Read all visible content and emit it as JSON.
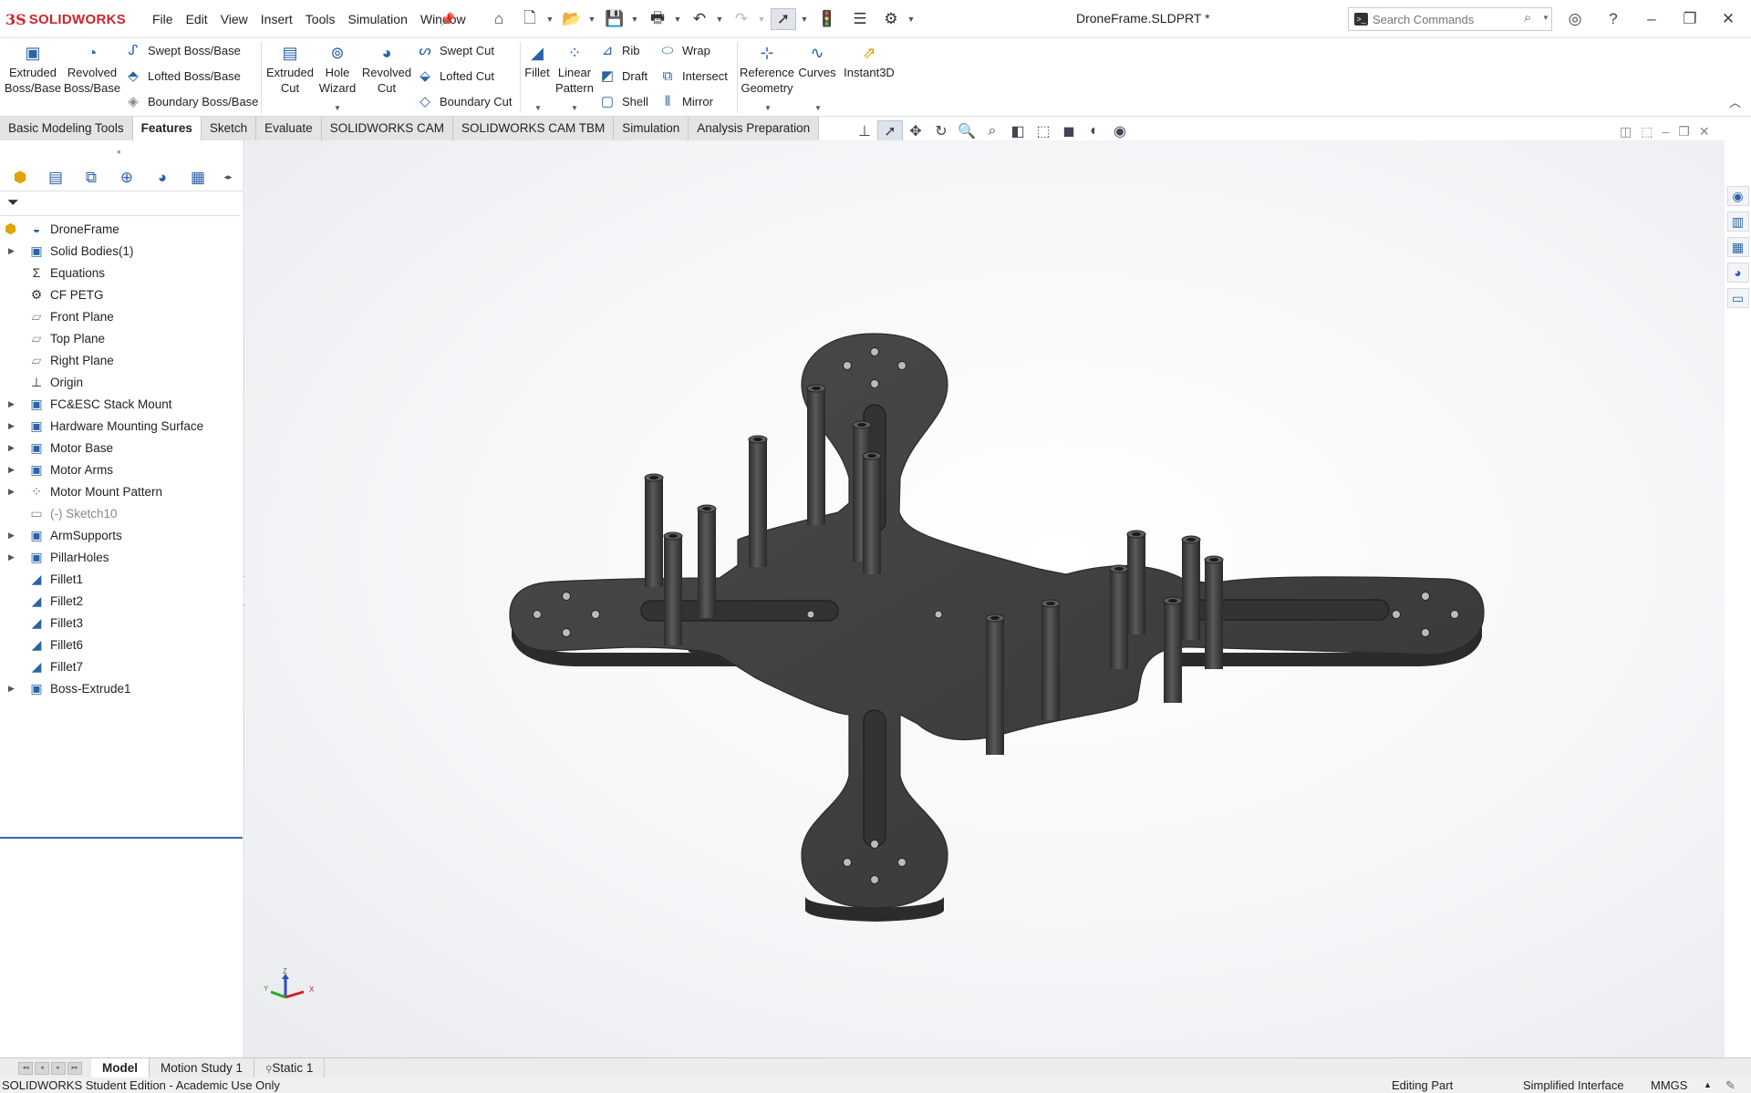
{
  "app": {
    "brand_mark": "3S",
    "brand_name": "SOLIDWORKS",
    "document_title": "DroneFrame.SLDPRT *"
  },
  "menu": [
    "File",
    "Edit",
    "View",
    "Insert",
    "Tools",
    "Simulation",
    "Window"
  ],
  "search": {
    "placeholder": "Search Commands"
  },
  "ribbon": {
    "extruded_boss": [
      "Extruded",
      "Boss/Base"
    ],
    "revolved_boss": [
      "Revolved",
      "Boss/Base"
    ],
    "swept_boss": "Swept Boss/Base",
    "lofted_boss": "Lofted Boss/Base",
    "boundary_boss": "Boundary Boss/Base",
    "extruded_cut": [
      "Extruded",
      "Cut"
    ],
    "hole_wizard": [
      "Hole",
      "Wizard"
    ],
    "revolved_cut": [
      "Revolved",
      "Cut"
    ],
    "swept_cut": "Swept Cut",
    "lofted_cut": "Lofted Cut",
    "boundary_cut": "Boundary Cut",
    "fillet": "Fillet",
    "linear_pattern": [
      "Linear",
      "Pattern"
    ],
    "rib": "Rib",
    "draft": "Draft",
    "shell": "Shell",
    "wrap": "Wrap",
    "intersect": "Intersect",
    "mirror": "Mirror",
    "reference_geometry": [
      "Reference",
      "Geometry"
    ],
    "curves": "Curves",
    "instant3d": "Instant3D"
  },
  "command_tabs": [
    "Basic Modeling Tools",
    "Features",
    "Sketch",
    "Evaluate",
    "SOLIDWORKS CAM",
    "SOLIDWORKS CAM TBM",
    "Simulation",
    "Analysis Preparation"
  ],
  "active_command_tab": "Features",
  "tree": {
    "root": "DroneFrame",
    "items": [
      {
        "label": "Solid Bodies(1)",
        "expandable": true,
        "icon": "folder-icon"
      },
      {
        "label": "Equations",
        "expandable": false,
        "icon": "sigma-icon"
      },
      {
        "label": "CF PETG",
        "expandable": false,
        "icon": "material-icon"
      },
      {
        "label": "Front Plane",
        "expandable": false,
        "icon": "plane-icon"
      },
      {
        "label": "Top Plane",
        "expandable": false,
        "icon": "plane-icon"
      },
      {
        "label": "Right Plane",
        "expandable": false,
        "icon": "plane-icon"
      },
      {
        "label": "Origin",
        "expandable": false,
        "icon": "origin-icon"
      },
      {
        "label": "FC&ESC Stack Mount",
        "expandable": true,
        "icon": "feature-icon"
      },
      {
        "label": "Hardware Mounting Surface",
        "expandable": true,
        "icon": "feature-icon"
      },
      {
        "label": "Motor Base",
        "expandable": true,
        "icon": "feature-icon"
      },
      {
        "label": "Motor Arms",
        "expandable": true,
        "icon": "feature-icon"
      },
      {
        "label": "Motor Mount Pattern",
        "expandable": true,
        "icon": "pattern-icon"
      },
      {
        "label": "(-) Sketch10",
        "expandable": false,
        "icon": "sketch-icon",
        "dim": true
      },
      {
        "label": "ArmSupports",
        "expandable": true,
        "icon": "feature-icon"
      },
      {
        "label": "PillarHoles",
        "expandable": true,
        "icon": "feature-icon"
      },
      {
        "label": "Fillet1",
        "expandable": false,
        "icon": "fillet-icon"
      },
      {
        "label": "Fillet2",
        "expandable": false,
        "icon": "fillet-icon"
      },
      {
        "label": "Fillet3",
        "expandable": false,
        "icon": "fillet-icon"
      },
      {
        "label": "Fillet6",
        "expandable": false,
        "icon": "fillet-icon"
      },
      {
        "label": "Fillet7",
        "expandable": false,
        "icon": "fillet-icon"
      },
      {
        "label": "Boss-Extrude1",
        "expandable": true,
        "icon": "feature-icon"
      }
    ]
  },
  "triad": {
    "x": "X",
    "y": "Y",
    "z": "Z"
  },
  "bottom_tabs": [
    "Model",
    "Motion Study 1",
    "Static 1"
  ],
  "active_bottom_tab": "Model",
  "status": {
    "left": "SOLIDWORKS Student Edition - Academic Use Only",
    "mode": "Editing Part",
    "interface": "Simplified Interface",
    "units": "MMGS"
  },
  "colors": {
    "brand": "#d2232a",
    "part": "#3e3e3e",
    "accent": "#2b62a8"
  }
}
